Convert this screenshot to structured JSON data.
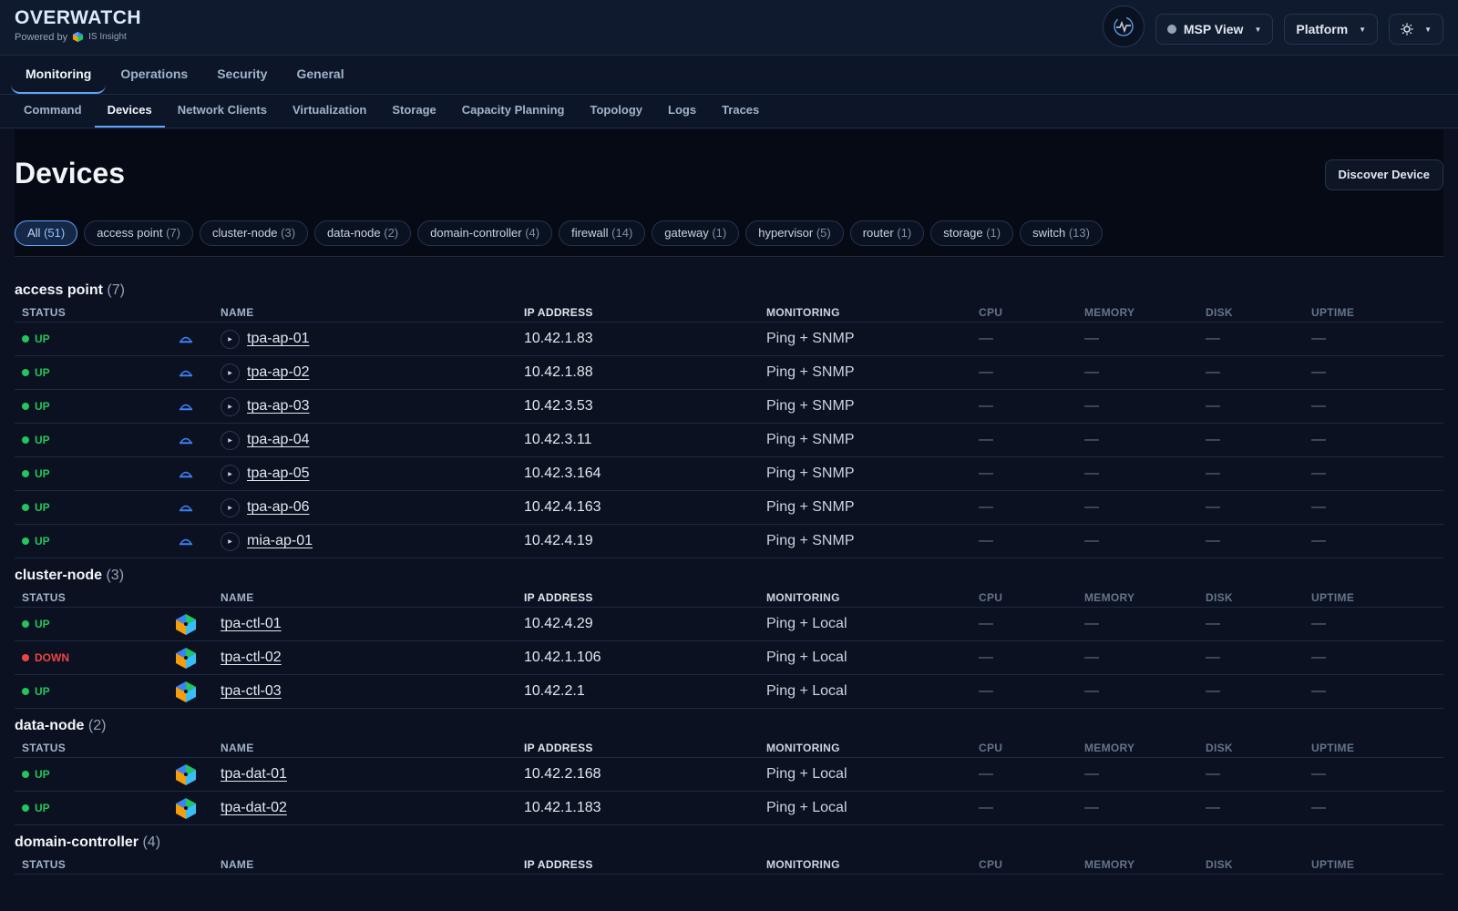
{
  "header": {
    "brand": "OVERWATCH",
    "powered_by": "Powered by",
    "powered_logo_text": "IS Insight",
    "msp_label": "MSP View",
    "platform_label": "Platform"
  },
  "tabs_primary": [
    {
      "label": "Monitoring",
      "active": true
    },
    {
      "label": "Operations",
      "active": false
    },
    {
      "label": "Security",
      "active": false
    },
    {
      "label": "General",
      "active": false
    }
  ],
  "tabs_secondary": [
    {
      "label": "Command",
      "active": false
    },
    {
      "label": "Devices",
      "active": true
    },
    {
      "label": "Network Clients",
      "active": false
    },
    {
      "label": "Virtualization",
      "active": false
    },
    {
      "label": "Storage",
      "active": false
    },
    {
      "label": "Capacity Planning",
      "active": false
    },
    {
      "label": "Topology",
      "active": false
    },
    {
      "label": "Logs",
      "active": false
    },
    {
      "label": "Traces",
      "active": false
    }
  ],
  "page": {
    "title": "Devices",
    "discover_label": "Discover Device"
  },
  "filters": [
    {
      "label": "All",
      "count": "(51)",
      "active": true
    },
    {
      "label": "access point",
      "count": "(7)"
    },
    {
      "label": "cluster-node",
      "count": "(3)"
    },
    {
      "label": "data-node",
      "count": "(2)"
    },
    {
      "label": "domain-controller",
      "count": "(4)"
    },
    {
      "label": "firewall",
      "count": "(14)"
    },
    {
      "label": "gateway",
      "count": "(1)"
    },
    {
      "label": "hypervisor",
      "count": "(5)"
    },
    {
      "label": "router",
      "count": "(1)"
    },
    {
      "label": "storage",
      "count": "(1)"
    },
    {
      "label": "switch",
      "count": "(13)"
    }
  ],
  "columns": {
    "status": "STATUS",
    "name": "NAME",
    "ip": "IP ADDRESS",
    "monitoring": "MONITORING",
    "cpu": "CPU",
    "memory": "MEMORY",
    "disk": "DISK",
    "uptime": "UPTIME"
  },
  "groups": [
    {
      "title": "access point",
      "count": "(7)",
      "icon": "access-point-icon",
      "expandable": true,
      "rows": [
        {
          "status": "UP",
          "name": "tpa-ap-01",
          "ip": "10.42.1.83",
          "monitoring": "Ping + SNMP",
          "cpu": "—",
          "memory": "—",
          "disk": "—",
          "uptime": "—"
        },
        {
          "status": "UP",
          "name": "tpa-ap-02",
          "ip": "10.42.1.88",
          "monitoring": "Ping + SNMP",
          "cpu": "—",
          "memory": "—",
          "disk": "—",
          "uptime": "—"
        },
        {
          "status": "UP",
          "name": "tpa-ap-03",
          "ip": "10.42.3.53",
          "monitoring": "Ping + SNMP",
          "cpu": "—",
          "memory": "—",
          "disk": "—",
          "uptime": "—"
        },
        {
          "status": "UP",
          "name": "tpa-ap-04",
          "ip": "10.42.3.11",
          "monitoring": "Ping + SNMP",
          "cpu": "—",
          "memory": "—",
          "disk": "—",
          "uptime": "—"
        },
        {
          "status": "UP",
          "name": "tpa-ap-05",
          "ip": "10.42.3.164",
          "monitoring": "Ping + SNMP",
          "cpu": "—",
          "memory": "—",
          "disk": "—",
          "uptime": "—"
        },
        {
          "status": "UP",
          "name": "tpa-ap-06",
          "ip": "10.42.4.163",
          "monitoring": "Ping + SNMP",
          "cpu": "—",
          "memory": "—",
          "disk": "—",
          "uptime": "—"
        },
        {
          "status": "UP",
          "name": "mia-ap-01",
          "ip": "10.42.4.19",
          "monitoring": "Ping + SNMP",
          "cpu": "—",
          "memory": "—",
          "disk": "—",
          "uptime": "—"
        }
      ]
    },
    {
      "title": "cluster-node",
      "count": "(3)",
      "icon": "vendor-logo-icon",
      "expandable": false,
      "rows": [
        {
          "status": "UP",
          "name": "tpa-ctl-01",
          "ip": "10.42.4.29",
          "monitoring": "Ping + Local",
          "cpu": "—",
          "memory": "—",
          "disk": "—",
          "uptime": "—"
        },
        {
          "status": "DOWN",
          "name": "tpa-ctl-02",
          "ip": "10.42.1.106",
          "monitoring": "Ping + Local",
          "cpu": "—",
          "memory": "—",
          "disk": "—",
          "uptime": "—"
        },
        {
          "status": "UP",
          "name": "tpa-ctl-03",
          "ip": "10.42.2.1",
          "monitoring": "Ping + Local",
          "cpu": "—",
          "memory": "—",
          "disk": "—",
          "uptime": "—"
        }
      ]
    },
    {
      "title": "data-node",
      "count": "(2)",
      "icon": "vendor-logo-icon",
      "expandable": false,
      "rows": [
        {
          "status": "UP",
          "name": "tpa-dat-01",
          "ip": "10.42.2.168",
          "monitoring": "Ping + Local",
          "cpu": "—",
          "memory": "—",
          "disk": "—",
          "uptime": "—"
        },
        {
          "status": "UP",
          "name": "tpa-dat-02",
          "ip": "10.42.1.183",
          "monitoring": "Ping + Local",
          "cpu": "—",
          "memory": "—",
          "disk": "—",
          "uptime": "—"
        }
      ]
    },
    {
      "title": "domain-controller",
      "count": "(4)",
      "icon": "vendor-logo-icon",
      "expandable": false,
      "rows": []
    }
  ],
  "colors": {
    "accent": "#60a5fa",
    "status_up": "#22c55e",
    "status_down": "#ef4444",
    "background": "#0b1120"
  }
}
